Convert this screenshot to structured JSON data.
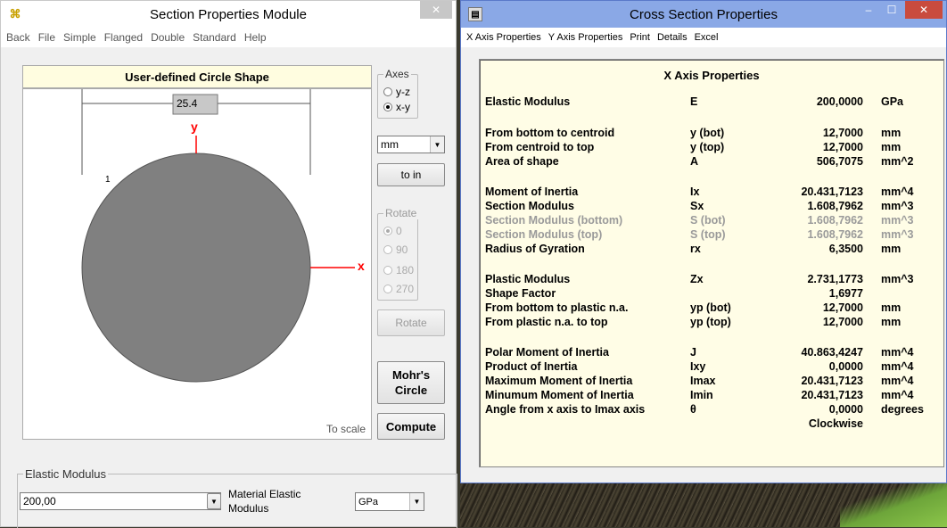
{
  "left_window": {
    "title": "Section Properties Module",
    "menu": [
      "Back",
      "File",
      "Simple",
      "Flanged",
      "Double",
      "Standard",
      "Help"
    ],
    "shape_header": "User-defined Circle Shape",
    "dimension_label": "25.4",
    "y_axis_label": "y",
    "x_axis_label": "x",
    "element_number": "1",
    "to_scale": "To scale",
    "axes": {
      "label": "Axes",
      "options": [
        "y-z",
        "x-y"
      ],
      "selected": "x-y"
    },
    "units_select": "mm",
    "to_in_button": "to in",
    "rotate": {
      "label": "Rotate",
      "options": [
        "0",
        "90",
        "180",
        "270"
      ],
      "selected": "0"
    },
    "rotate_button": "Rotate",
    "mohrs_button_line1": "Mohr's",
    "mohrs_button_line2": "Circle",
    "compute_button": "Compute",
    "elastic_modulus": {
      "label": "Elastic Modulus",
      "value": "200,00",
      "material_label_line1": "Material Elastic",
      "material_label_line2": "Modulus",
      "unit": "GPa"
    },
    "colors": {
      "circle_fill": "#808080",
      "axis": "#ff0000",
      "header_bg": "#fffde0"
    }
  },
  "right_window": {
    "title": "Cross Section Properties",
    "menu": [
      "X Axis Properties",
      "Y Axis Properties",
      "Print",
      "Details",
      "Excel"
    ],
    "panel_title": "X Axis Properties",
    "rows": [
      {
        "name": "Elastic Modulus",
        "symbol": "E",
        "value": "200,0000",
        "unit": "GPa",
        "dim": false
      },
      {
        "name": "From bottom to centroid",
        "symbol": "y (bot)",
        "value": "12,7000",
        "unit": "mm",
        "dim": false
      },
      {
        "name": "From centroid to top",
        "symbol": "y (top)",
        "value": "12,7000",
        "unit": "mm",
        "dim": false
      },
      {
        "name": "Area of shape",
        "symbol": "A",
        "value": "506,7075",
        "unit": "mm^2",
        "dim": false
      },
      {
        "name": "Moment of Inertia",
        "symbol": "Ix",
        "value": "20.431,7123",
        "unit": "mm^4",
        "dim": false
      },
      {
        "name": "Section Modulus",
        "symbol": "Sx",
        "value": "1.608,7962",
        "unit": "mm^3",
        "dim": false
      },
      {
        "name": "Section Modulus (bottom)",
        "symbol": "S (bot)",
        "value": "1.608,7962",
        "unit": "mm^3",
        "dim": true
      },
      {
        "name": "Section Modulus (top)",
        "symbol": "S (top)",
        "value": "1.608,7962",
        "unit": "mm^3",
        "dim": true
      },
      {
        "name": "Radius of Gyration",
        "symbol": "rx",
        "value": "6,3500",
        "unit": "mm",
        "dim": false
      },
      {
        "name": "Plastic Modulus",
        "symbol": "Zx",
        "value": "2.731,1773",
        "unit": "mm^3",
        "dim": false
      },
      {
        "name": "Shape Factor",
        "symbol": "",
        "value": "1,6977",
        "unit": "",
        "dim": false
      },
      {
        "name": "From bottom to plastic n.a.",
        "symbol": "yp (bot)",
        "value": "12,7000",
        "unit": "mm",
        "dim": false
      },
      {
        "name": "From plastic n.a. to top",
        "symbol": "yp (top)",
        "value": "12,7000",
        "unit": "mm",
        "dim": false
      },
      {
        "name": "Polar Moment of Inertia",
        "symbol": "J",
        "value": "40.863,4247",
        "unit": "mm^4",
        "dim": false
      },
      {
        "name": "Product of Inertia",
        "symbol": "Ixy",
        "value": "0,0000",
        "unit": "mm^4",
        "dim": false
      },
      {
        "name": "Maximum Moment of Inertia",
        "symbol": "Imax",
        "value": "20.431,7123",
        "unit": "mm^4",
        "dim": false
      },
      {
        "name": "Minumum Moment of Inertia",
        "symbol": "Imin",
        "value": "20.431,7123",
        "unit": "mm^4",
        "dim": false
      },
      {
        "name": "Angle from x axis to Imax axis",
        "symbol": "θ",
        "value": "0,0000",
        "unit": "degrees",
        "dim": false
      },
      {
        "name": "",
        "symbol": "",
        "value": "Clockwise",
        "unit": "",
        "dim": false
      }
    ],
    "colors": {
      "panel_bg": "#fffde6",
      "title_bg": "#8aa8e6",
      "dim_text": "#9a9a9a"
    }
  }
}
